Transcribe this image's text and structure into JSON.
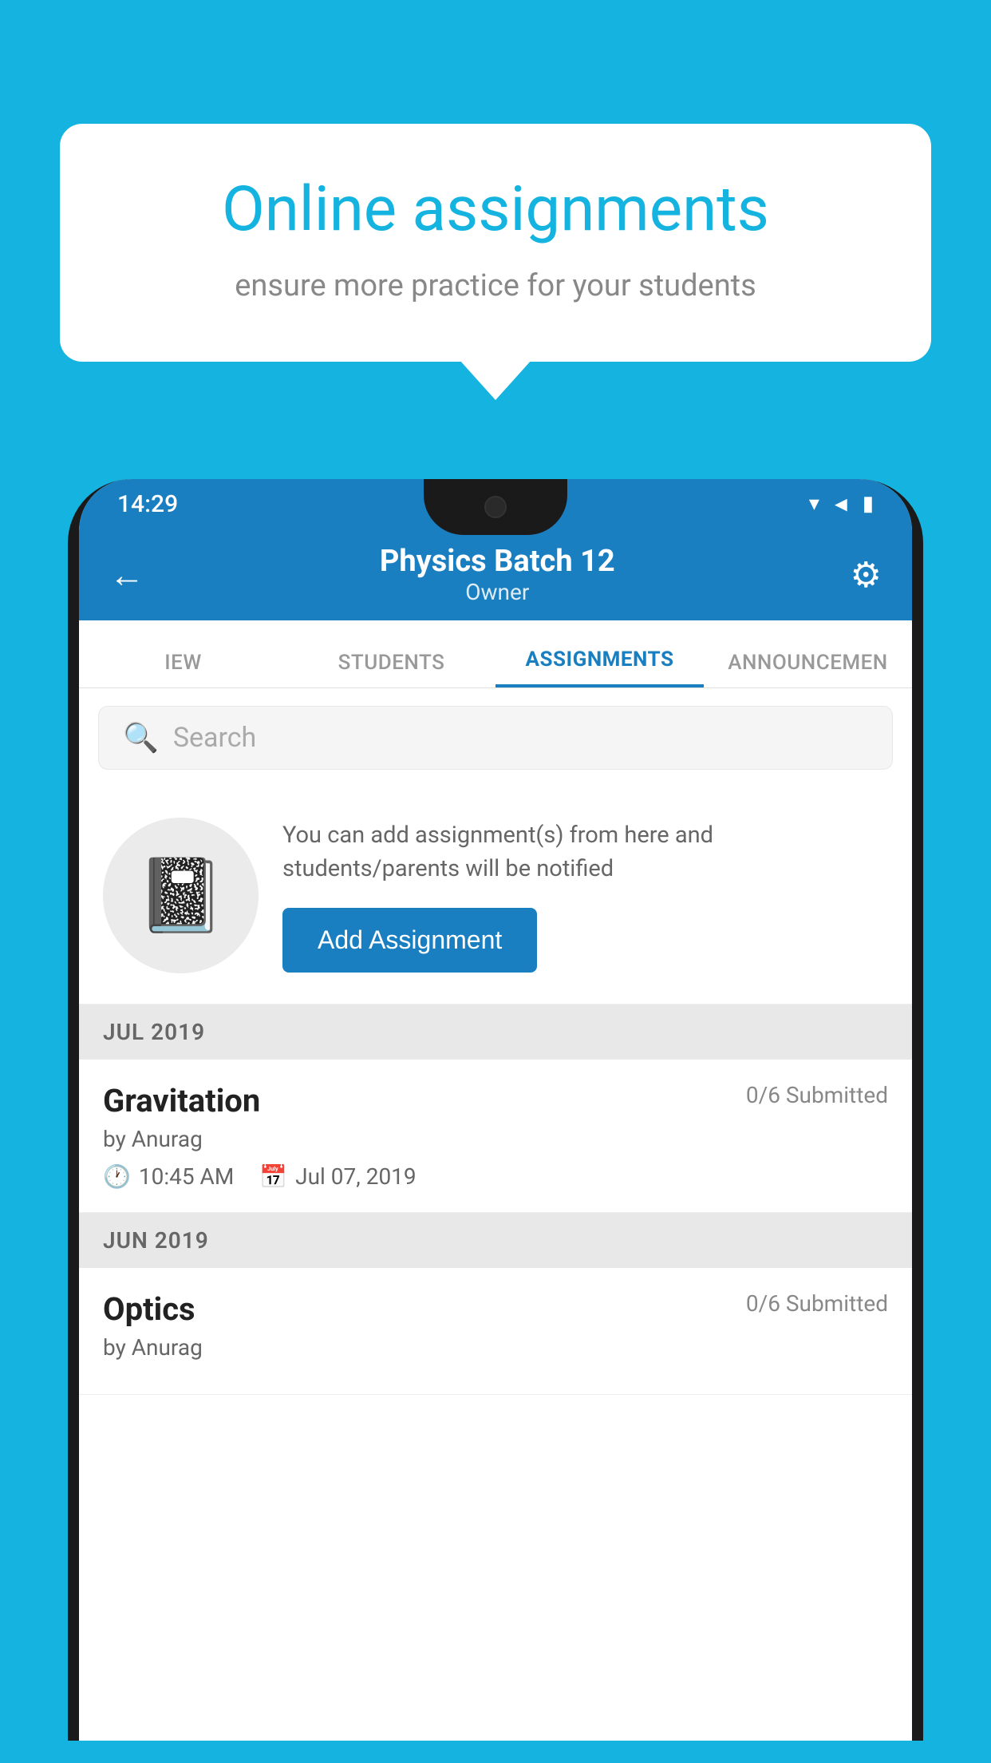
{
  "background": {
    "color": "#15b3e0"
  },
  "speech_bubble": {
    "title": "Online assignments",
    "subtitle": "ensure more practice for your students"
  },
  "phone": {
    "status_bar": {
      "time": "14:29",
      "wifi_icon": "▾",
      "signal_icon": "◄",
      "battery_icon": "▮"
    },
    "header": {
      "title": "Physics Batch 12",
      "subtitle": "Owner",
      "back_icon": "←",
      "settings_icon": "⚙"
    },
    "tabs": [
      {
        "label": "IEW",
        "active": false
      },
      {
        "label": "STUDENTS",
        "active": false
      },
      {
        "label": "ASSIGNMENTS",
        "active": true
      },
      {
        "label": "ANNOUNCEMENTS",
        "active": false
      }
    ],
    "search": {
      "placeholder": "Search"
    },
    "promo": {
      "description": "You can add assignment(s) from here and students/parents will be notified",
      "button_label": "Add Assignment"
    },
    "sections": [
      {
        "month": "JUL 2019",
        "assignments": [
          {
            "title": "Gravitation",
            "submitted": "0/6 Submitted",
            "author": "by Anurag",
            "time": "10:45 AM",
            "date": "Jul 07, 2019"
          }
        ]
      },
      {
        "month": "JUN 2019",
        "assignments": [
          {
            "title": "Optics",
            "submitted": "0/6 Submitted",
            "author": "by Anurag",
            "time": "",
            "date": ""
          }
        ]
      }
    ]
  }
}
